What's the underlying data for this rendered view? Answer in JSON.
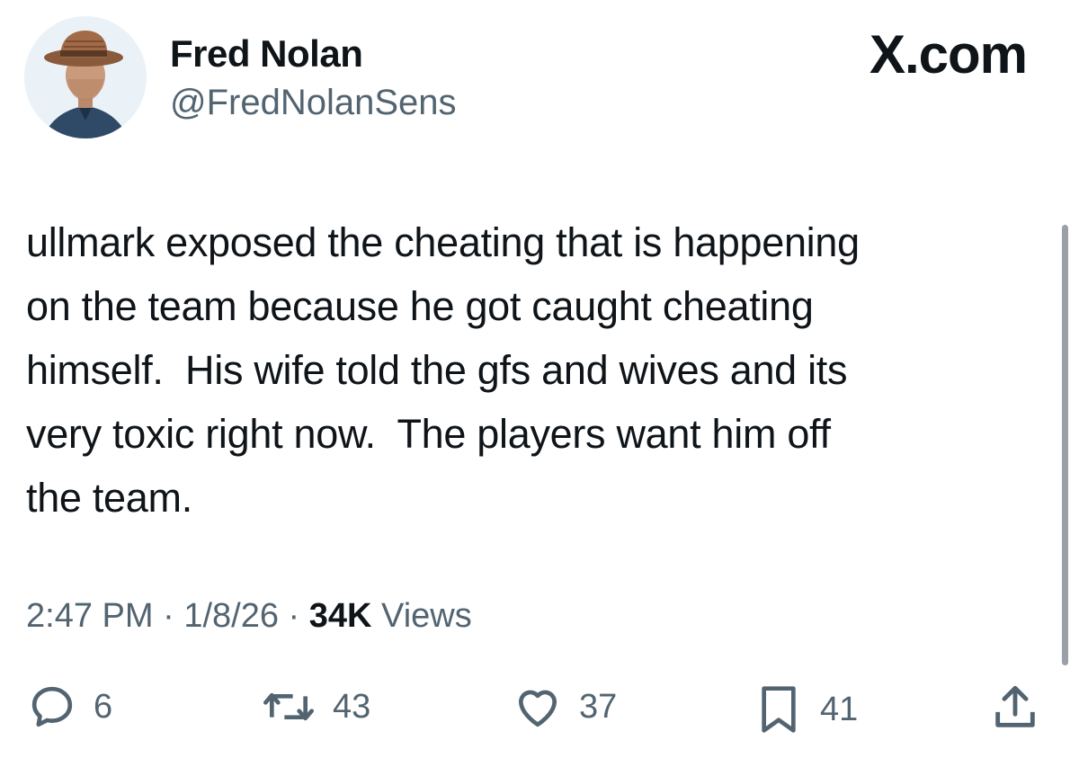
{
  "author": {
    "name": "Fred Nolan",
    "handle": "@FredNolanSens"
  },
  "brand": "X.com",
  "tweet": {
    "text": "ullmark exposed the cheating that is happening\non the team because he got caught cheating\nhimself.  His wife told the gfs and wives and its\nvery toxic right now.  The players want him off\nthe team."
  },
  "meta": {
    "time": "2:47 PM",
    "separator": "·",
    "date": "1/8/26",
    "views_count": "34K",
    "views_label": "Views"
  },
  "actions": {
    "replies": "6",
    "reposts": "43",
    "likes": "37",
    "bookmarks": "41"
  },
  "icons": {
    "reply": "reply-icon",
    "repost": "repost-icon",
    "like": "heart-icon",
    "bookmark": "bookmark-icon",
    "share": "share-icon"
  },
  "colors": {
    "text": "#0f1419",
    "muted": "#536471",
    "background": "#ffffff"
  }
}
